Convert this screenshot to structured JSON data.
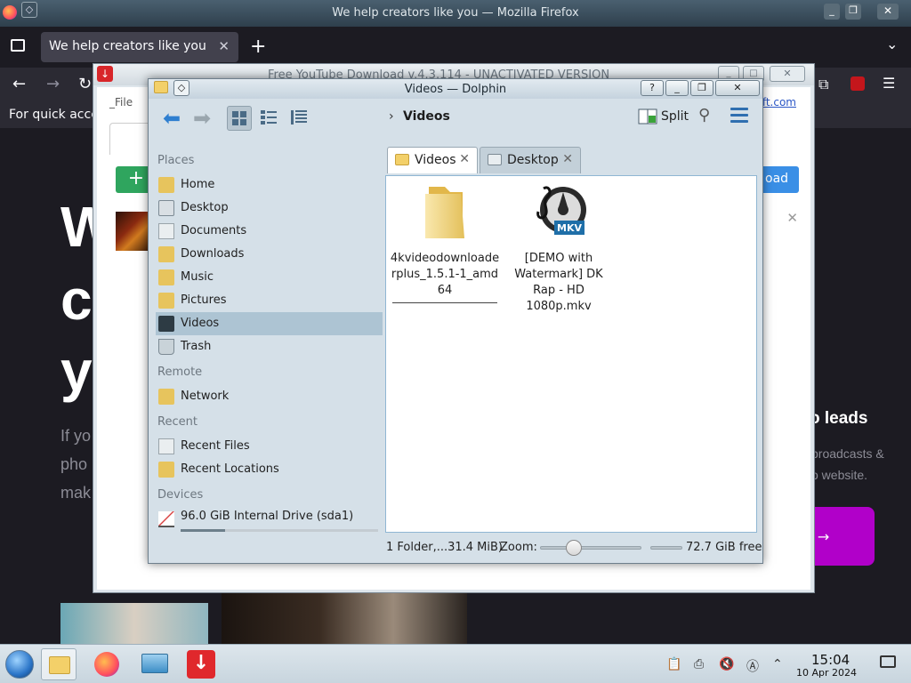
{
  "firefox": {
    "window_title": "We help creators like you — Mozilla Firefox",
    "tab_title": "We help creators like you",
    "bookmarks_text": "For quick acce",
    "content": {
      "hero_letters": [
        "W",
        "c",
        "y"
      ],
      "grey_lines": [
        "If yo",
        "pho",
        "mak"
      ],
      "right_heading": "o leads",
      "right_lines": [
        "broadcasts &",
        "o website."
      ],
      "cta": "e →"
    }
  },
  "downloader": {
    "title": "Free YouTube Download v.4.3.114 - UNACTIVATED VERSION",
    "menu_file": "_File",
    "link": "www.dvdvideosoft.com",
    "download_label": "oad"
  },
  "dolphin": {
    "title": "Videos — Dolphin",
    "breadcrumb": "Videos",
    "split_label": "Split",
    "tabs": [
      {
        "label": "Videos",
        "icon": "folder-icon"
      },
      {
        "label": "Desktop",
        "icon": "desktop-icon"
      }
    ],
    "places": {
      "places_heading": "Places",
      "places_items": [
        "Home",
        "Desktop",
        "Documents",
        "Downloads",
        "Music",
        "Pictures",
        "Videos",
        "Trash"
      ],
      "remote_heading": "Remote",
      "remote_items": [
        "Network"
      ],
      "recent_heading": "Recent",
      "recent_items": [
        "Recent Files",
        "Recent Locations"
      ],
      "devices_heading": "Devices",
      "device": "96.0 GiB Internal Drive (sda1)",
      "device_used_fraction": 0.225
    },
    "files": [
      {
        "name": "4kvideodownloaderplus_1.5.1-1_amd64",
        "kind": "folder"
      },
      {
        "name": "[DEMO with Watermark] DK Rap - HD 1080p.mkv",
        "kind": "mkv"
      }
    ],
    "status": {
      "summary": "1 Folder,...31.4 MiB)",
      "zoom_label": "Zoom:",
      "free_space": "72.7 GiB free"
    }
  },
  "taskbar": {
    "time": "15:04",
    "date": "10 Apr 2024"
  }
}
